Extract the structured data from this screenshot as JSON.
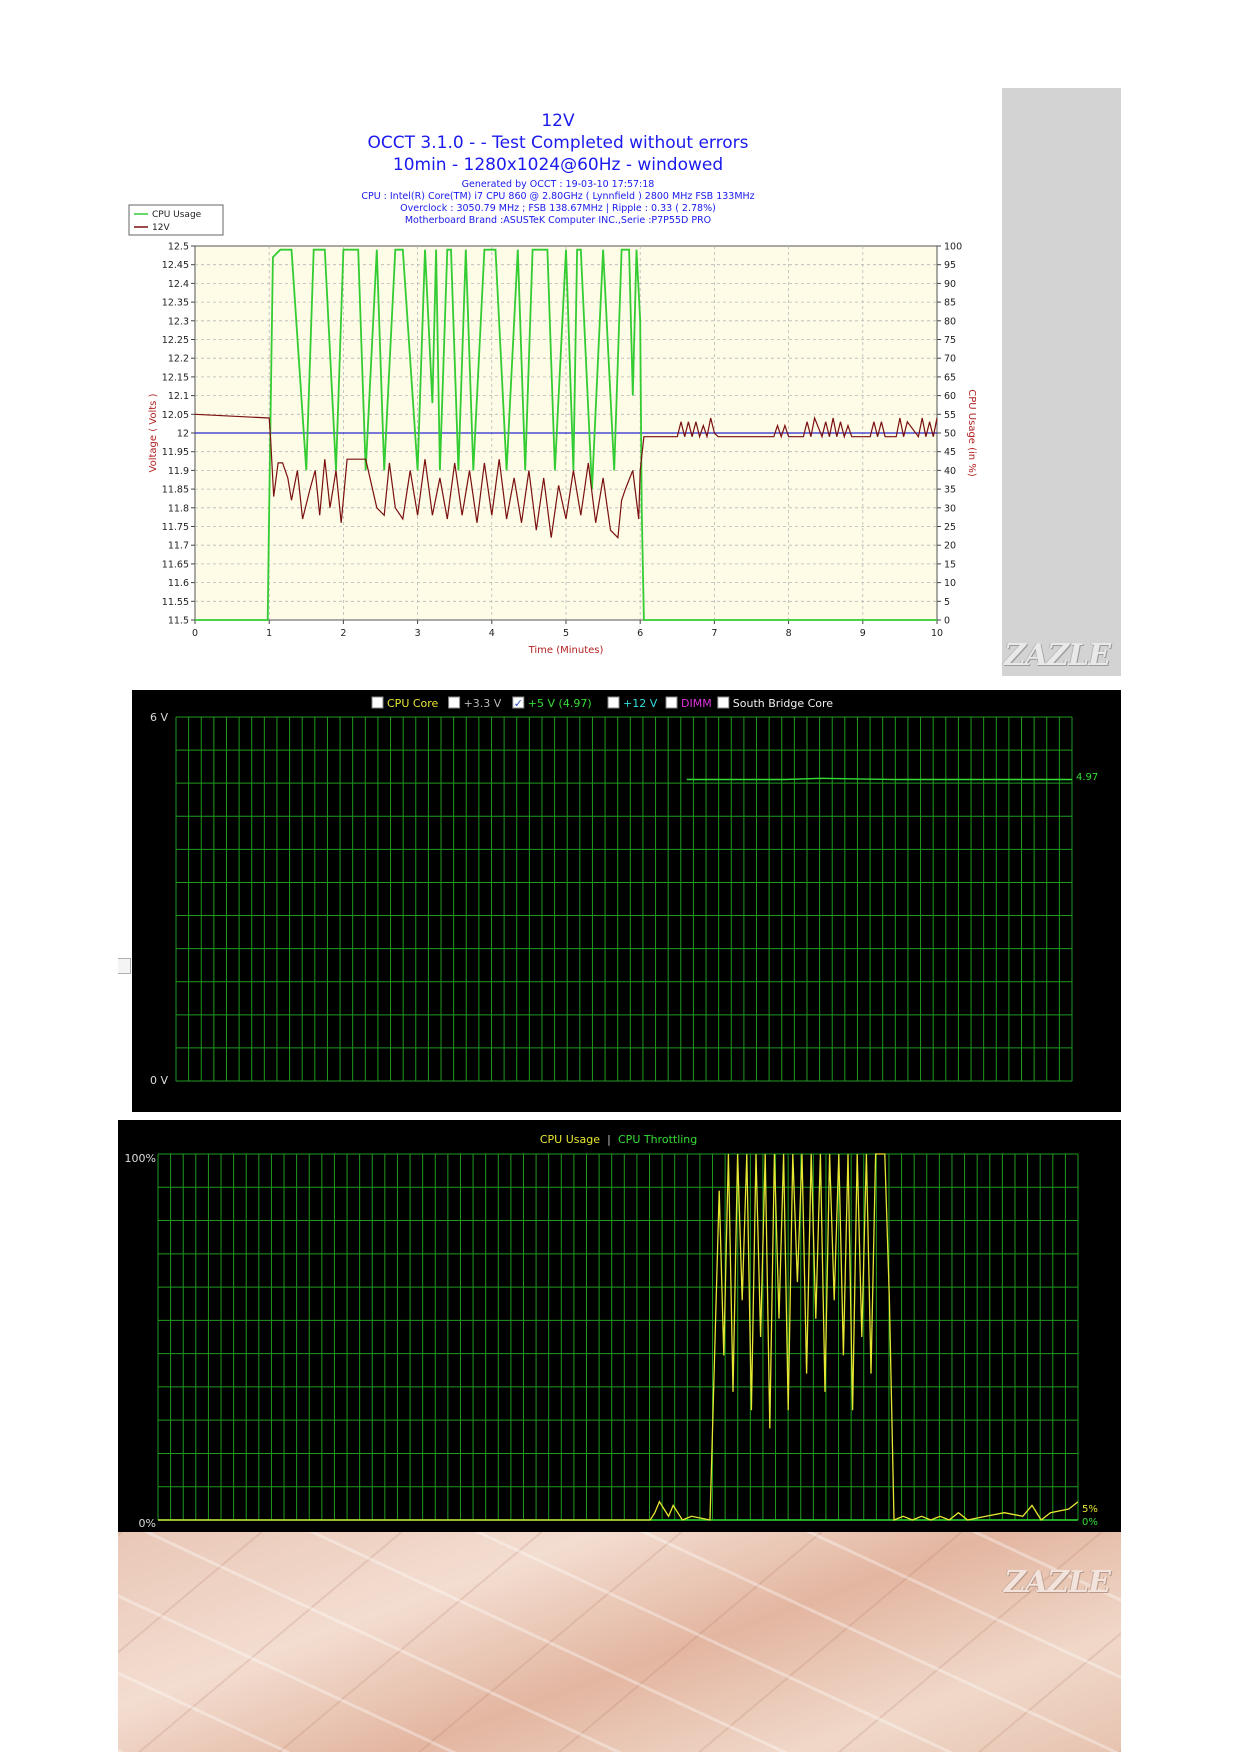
{
  "occt": {
    "title": "12V",
    "subtitle": "OCCT 3.1.0 -  - Test Completed without errors",
    "subtitle2": "10min - 1280x1024@60Hz - windowed",
    "info": [
      "Generated by OCCT : 19-03-10 17:57:18",
      "CPU : Intel(R) Core(TM) i7 CPU 860 @ 2.80GHz ( Lynnfield ) 2800 MHz FSB 133MHz",
      "Overclock : 3050.79 MHz ; FSB 138.67MHz | Ripple : 0.33 ( 2.78%)",
      "Motherboard Brand :ASUSTeK Computer INC.,Serie :P7P55D PRO"
    ],
    "legend": [
      "CPU Usage",
      "12V"
    ],
    "xlabel": "Time (Minutes)",
    "ylabel_left": "Voltage ( Volts )",
    "ylabel_right": "CPU Usage (in %)",
    "colors": {
      "title": "#1a1aee",
      "cpu": "#33cc33",
      "volt": "#7a1010",
      "ref": "#2a2ad0",
      "plotbg": "#fefbe6"
    }
  },
  "logo_text": "ZAZLE",
  "monitor1": {
    "legend": [
      {
        "label": "CPU Core",
        "checked": false,
        "color": "#e6e633"
      },
      {
        "label": "+3.3 V",
        "checked": false,
        "color": "#bbbbbb"
      },
      {
        "label": "+5 V (4.97)",
        "checked": true,
        "color": "#33dd33"
      },
      {
        "label": "+12 V",
        "checked": false,
        "color": "#33dddd"
      },
      {
        "label": "DIMM",
        "checked": false,
        "color": "#dd33dd"
      },
      {
        "label": "South Bridge Core",
        "checked": false,
        "color": "#f0f0f0"
      }
    ],
    "y_top": "6 V",
    "y_bottom": "0 V",
    "value_label": "4.97"
  },
  "monitor2": {
    "legend": [
      {
        "label": "CPU Usage",
        "color": "#e6e633"
      },
      {
        "label": "CPU Throttling",
        "color": "#33dd33"
      }
    ],
    "separator": "|",
    "y_top": "100%",
    "y_bottom": "0%",
    "end_usage": "5%",
    "end_throttle": "0%"
  },
  "chart_data": [
    {
      "type": "line",
      "title": "12V",
      "xlabel": "Time (Minutes)",
      "ylabel": "Voltage ( Volts )",
      "y2label": "CPU Usage (in %)",
      "xlim": [
        0,
        10
      ],
      "ylim": [
        11.5,
        12.5
      ],
      "y2lim": [
        0,
        100
      ],
      "x_ticks": [
        "0",
        "1",
        "2",
        "3",
        "4",
        "5",
        "6",
        "7",
        "8",
        "9",
        "10"
      ],
      "y_ticks": [
        "11.5",
        "11.55",
        "11.6",
        "11.65",
        "11.7",
        "11.75",
        "11.8",
        "11.85",
        "11.9",
        "11.95",
        "12",
        "12.05",
        "12.1",
        "12.15",
        "12.2",
        "12.25",
        "12.3",
        "12.35",
        "12.4",
        "12.45",
        "12.5"
      ],
      "y2_ticks": [
        "0",
        "5",
        "10",
        "15",
        "20",
        "25",
        "30",
        "35",
        "40",
        "45",
        "50",
        "55",
        "60",
        "65",
        "70",
        "75",
        "80",
        "85",
        "90",
        "95",
        "100"
      ],
      "reference_line": 12.0,
      "grid": true,
      "legend_position": "top-left",
      "series": [
        {
          "name": "CPU Usage",
          "axis": "right",
          "x": [
            0,
            0.98,
            1.0,
            1.05,
            1.15,
            1.3,
            1.5,
            1.6,
            1.75,
            1.9,
            2.0,
            2.2,
            2.3,
            2.45,
            2.55,
            2.7,
            2.8,
            3.0,
            3.1,
            3.2,
            3.25,
            3.3,
            3.4,
            3.45,
            3.55,
            3.65,
            3.75,
            3.9,
            4.05,
            4.2,
            4.35,
            4.45,
            4.55,
            4.75,
            4.85,
            5.0,
            5.1,
            5.15,
            5.2,
            5.35,
            5.5,
            5.65,
            5.75,
            5.85,
            5.9,
            5.95,
            6.0,
            6.02,
            6.05,
            10
          ],
          "values": [
            0,
            0,
            30,
            97,
            99,
            99,
            40,
            99,
            99,
            40,
            99,
            99,
            40,
            99,
            40,
            99,
            99,
            40,
            99,
            58,
            99,
            40,
            99,
            99,
            40,
            99,
            40,
            99,
            99,
            40,
            99,
            40,
            99,
            99,
            40,
            99,
            40,
            99,
            99,
            35,
            99,
            40,
            99,
            99,
            60,
            99,
            80,
            30,
            0,
            0
          ]
        },
        {
          "name": "12V",
          "axis": "left",
          "x": [
            0,
            1.0,
            1.02,
            1.06,
            1.12,
            1.18,
            1.25,
            1.3,
            1.38,
            1.45,
            1.55,
            1.62,
            1.68,
            1.75,
            1.82,
            1.9,
            1.97,
            2.05,
            2.15,
            2.3,
            2.45,
            2.55,
            2.62,
            2.7,
            2.8,
            2.9,
            3.0,
            3.1,
            3.2,
            3.3,
            3.4,
            3.5,
            3.6,
            3.7,
            3.8,
            3.9,
            4.0,
            4.1,
            4.2,
            4.3,
            4.4,
            4.5,
            4.6,
            4.7,
            4.8,
            4.9,
            5.0,
            5.1,
            5.2,
            5.3,
            5.4,
            5.5,
            5.6,
            5.7,
            5.75,
            5.8,
            5.9,
            5.98,
            6.0,
            6.05,
            6.5,
            6.55,
            6.6,
            6.65,
            6.7,
            6.75,
            6.8,
            6.85,
            6.9,
            6.95,
            7.0,
            7.05,
            7.1,
            7.15,
            7.8,
            7.85,
            7.9,
            7.95,
            8.0,
            8.2,
            8.25,
            8.3,
            8.35,
            8.45,
            8.5,
            8.55,
            8.6,
            8.65,
            8.7,
            8.75,
            8.8,
            8.85,
            8.9,
            9.1,
            9.15,
            9.2,
            9.25,
            9.3,
            9.45,
            9.5,
            9.55,
            9.6,
            9.75,
            9.8,
            9.85,
            9.9,
            9.95,
            10
          ],
          "values": [
            12.05,
            12.04,
            11.98,
            11.83,
            11.92,
            11.92,
            11.88,
            11.82,
            11.9,
            11.77,
            11.85,
            11.9,
            11.78,
            11.93,
            11.8,
            11.9,
            11.76,
            11.93,
            11.93,
            11.93,
            11.8,
            11.78,
            11.92,
            11.8,
            11.77,
            11.9,
            11.78,
            11.93,
            11.78,
            11.88,
            11.77,
            11.92,
            11.78,
            11.9,
            11.76,
            11.92,
            11.78,
            11.93,
            11.77,
            11.88,
            11.76,
            11.9,
            11.74,
            11.88,
            11.72,
            11.86,
            11.77,
            11.9,
            11.78,
            11.92,
            11.76,
            11.88,
            11.74,
            11.72,
            11.82,
            11.85,
            11.9,
            11.77,
            11.9,
            11.99,
            11.99,
            12.03,
            11.99,
            12.03,
            11.99,
            12.03,
            11.99,
            12.02,
            11.99,
            12.04,
            12.0,
            11.99,
            11.99,
            11.99,
            11.99,
            12.02,
            11.99,
            12.02,
            11.99,
            11.99,
            12.03,
            11.99,
            12.04,
            11.99,
            12.03,
            11.99,
            12.04,
            11.99,
            12.03,
            11.99,
            12.02,
            11.99,
            11.99,
            11.99,
            12.03,
            11.99,
            12.03,
            11.99,
            11.99,
            12.04,
            11.99,
            12.03,
            11.99,
            12.04,
            11.99,
            12.03,
            11.99,
            12.04
          ]
        }
      ]
    },
    {
      "type": "line",
      "title": "",
      "ylim": [
        0,
        6
      ],
      "grid": true,
      "series": [
        {
          "name": "+5 V (4.97)",
          "x": [
            0.57,
            0.68,
            0.72,
            0.76,
            0.8,
            1.0
          ],
          "values": [
            4.97,
            4.97,
            4.99,
            4.98,
            4.97,
            4.97
          ]
        }
      ]
    },
    {
      "type": "line",
      "title": "",
      "ylim": [
        0,
        100
      ],
      "grid": true,
      "series": [
        {
          "name": "CPU Usage",
          "x": [
            0.0,
            0.535,
            0.54,
            0.545,
            0.55,
            0.555,
            0.56,
            0.565,
            0.57,
            0.58,
            0.6,
            0.61,
            0.615,
            0.62,
            0.625,
            0.63,
            0.635,
            0.64,
            0.645,
            0.65,
            0.655,
            0.66,
            0.665,
            0.67,
            0.675,
            0.68,
            0.685,
            0.69,
            0.695,
            0.7,
            0.705,
            0.71,
            0.715,
            0.72,
            0.725,
            0.73,
            0.735,
            0.74,
            0.745,
            0.75,
            0.755,
            0.76,
            0.765,
            0.77,
            0.775,
            0.78,
            0.79,
            0.795,
            0.8,
            0.81,
            0.82,
            0.83,
            0.84,
            0.85,
            0.86,
            0.87,
            0.88,
            0.9,
            0.92,
            0.94,
            0.95,
            0.96,
            0.97,
            0.99,
            1.0
          ],
          "values": [
            0,
            0,
            2,
            5,
            3,
            1,
            4,
            2,
            0,
            1,
            0,
            90,
            45,
            100,
            35,
            100,
            60,
            100,
            30,
            100,
            50,
            100,
            25,
            100,
            55,
            100,
            30,
            100,
            65,
            100,
            40,
            100,
            55,
            100,
            35,
            100,
            60,
            100,
            45,
            100,
            30,
            100,
            50,
            100,
            40,
            100,
            100,
            60,
            0,
            1,
            0,
            1,
            0,
            1,
            0,
            2,
            0,
            1,
            2,
            1,
            4,
            0,
            2,
            3,
            5
          ]
        },
        {
          "name": "CPU Throttling",
          "x": [
            0,
            1
          ],
          "values": [
            0,
            0
          ]
        }
      ]
    }
  ]
}
